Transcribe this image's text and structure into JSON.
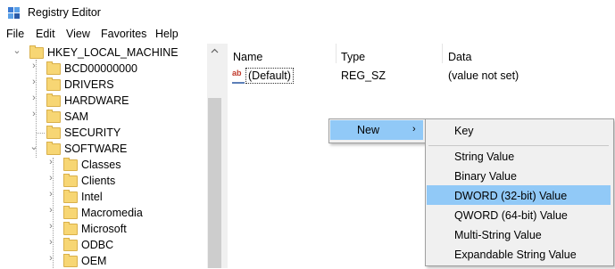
{
  "window": {
    "title": "Registry Editor"
  },
  "menu": [
    "File",
    "Edit",
    "View",
    "Favorites",
    "Help"
  ],
  "tree": {
    "root": "HKEY_LOCAL_MACHINE",
    "children": [
      "BCD00000000",
      "DRIVERS",
      "HARDWARE",
      "SAM",
      "SECURITY",
      "SOFTWARE"
    ],
    "software_children": [
      "Classes",
      "Clients",
      "Intel",
      "Macromedia",
      "Microsoft",
      "ODBC",
      "OEM"
    ]
  },
  "list": {
    "columns": [
      "Name",
      "Type",
      "Data"
    ],
    "rows": [
      {
        "name": "(Default)",
        "type": "REG_SZ",
        "data": "(value not set)"
      }
    ]
  },
  "context_menu": {
    "new_label": "New",
    "submenu": [
      "Key",
      "String Value",
      "Binary Value",
      "DWORD (32-bit) Value",
      "QWORD (64-bit) Value",
      "Multi-String Value",
      "Expandable String Value"
    ],
    "highlighted": "DWORD (32-bit) Value"
  },
  "colors": {
    "highlight": "#91c9f7",
    "folder": "#f7d674"
  }
}
